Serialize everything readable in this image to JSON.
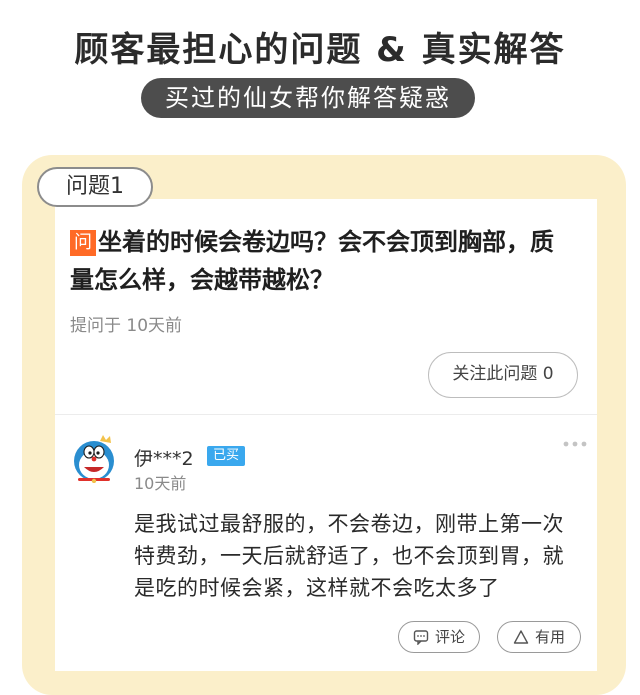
{
  "header": {
    "title": "顾客最担心的问题 & 真实解答",
    "subtitle": "买过的仙女帮你解答疑惑"
  },
  "question": {
    "tag": "问题1",
    "badge": "问",
    "text": "坐着的时候会卷边吗？会不会顶到胸部，质量怎么样，会越带越松？",
    "asked_time": "提问于 10天前",
    "follow_label": "关注此问题 0"
  },
  "answer": {
    "username": "伊***2",
    "bought_badge": "已买",
    "time": "10天前",
    "text": "是我试过最舒服的，不会卷边，刚带上第一次特费劲，一天后就舒适了，也不会顶到胃，就是吃的时候会紧，这样就不会吃太多了",
    "comment_label": "评论",
    "useful_label": "有用",
    "avatar_icon": "doraemon-avatar-icon"
  },
  "colors": {
    "card_background": "#fbefca",
    "ask_badge": "#ff6a26",
    "bought_badge": "#3aa8ee",
    "subtitle_pill": "#4d4d4d"
  }
}
